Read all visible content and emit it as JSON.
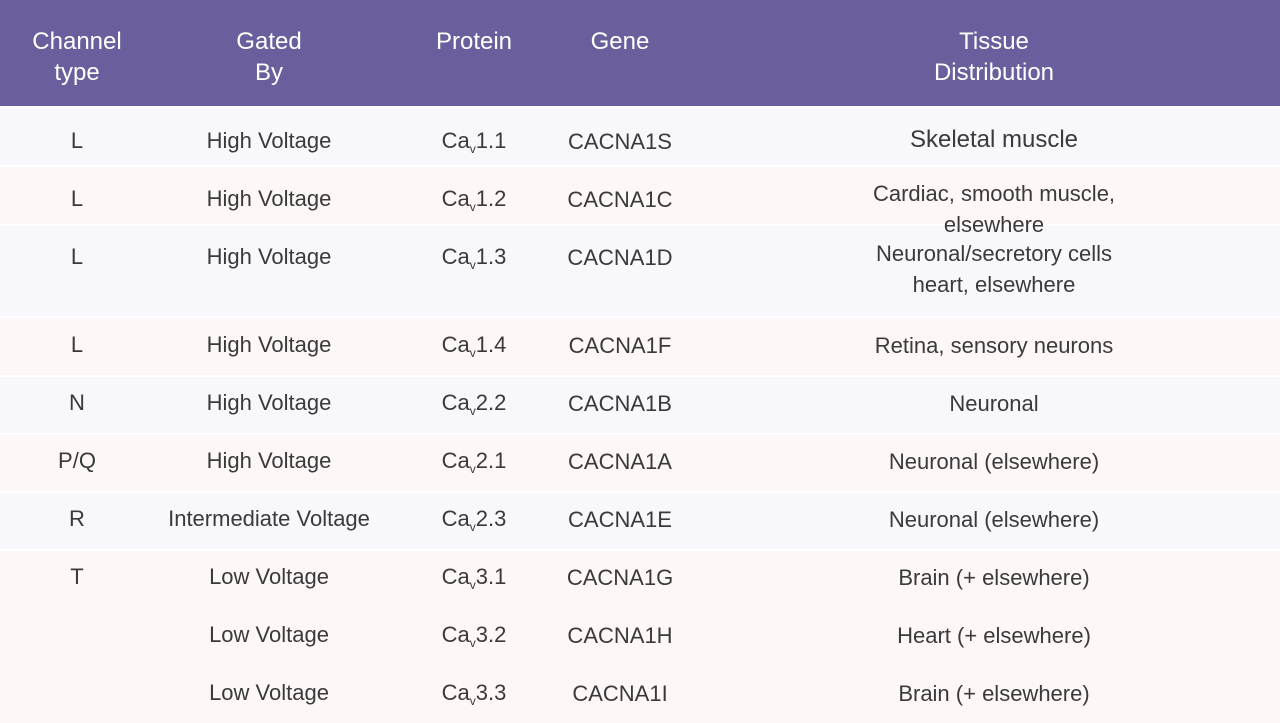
{
  "header": {
    "channel_type": "Channel\ntype",
    "gated_by": "Gated\nBy",
    "protein": "Protein",
    "gene": "Gene",
    "tissue": "Tissue\nDistribution"
  },
  "colors": {
    "header_bg": "#6a5f9c",
    "row_a": "#f7f7fc",
    "row_b": "#fdf8f7"
  },
  "rows": [
    {
      "type": "L",
      "gated": "High Voltage",
      "protein_base": "Ca",
      "protein_sub": "v",
      "protein_num": "1.1",
      "gene": "CACNA1S",
      "tissue": "Skeletal muscle"
    },
    {
      "type": "L",
      "gated": "High Voltage",
      "protein_base": "Ca",
      "protein_sub": "v",
      "protein_num": "1.2",
      "gene": "CACNA1C",
      "tissue": "Cardiac, smooth muscle, elsewhere"
    },
    {
      "type": "L",
      "gated": "High Voltage",
      "protein_base": "Ca",
      "protein_sub": "v",
      "protein_num": "1.3",
      "gene": "CACNA1D",
      "tissue": "Neuronal/secretory cells\nheart, elsewhere"
    },
    {
      "type": "L",
      "gated": "High Voltage",
      "protein_base": "Ca",
      "protein_sub": "v",
      "protein_num": "1.4",
      "gene": "CACNA1F",
      "tissue": "Retina, sensory neurons"
    },
    {
      "type": "N",
      "gated": "High Voltage",
      "protein_base": "Ca",
      "protein_sub": "v",
      "protein_num": "2.2",
      "gene": "CACNA1B",
      "tissue": "Neuronal"
    },
    {
      "type": "P/Q",
      "gated": "High Voltage",
      "protein_base": "Ca",
      "protein_sub": "v",
      "protein_num": "2.1",
      "gene": "CACNA1A",
      "tissue": "Neuronal (elsewhere)"
    },
    {
      "type": "R",
      "gated": "Intermediate Voltage",
      "protein_base": "Ca",
      "protein_sub": "v",
      "protein_num": "2.3",
      "gene": "CACNA1E",
      "tissue": "Neuronal (elsewhere)"
    },
    {
      "type": "T",
      "gated": "Low Voltage",
      "protein_base": "Ca",
      "protein_sub": "v",
      "protein_num": "3.1",
      "gene": "CACNA1G",
      "tissue": "Brain (+ elsewhere)"
    },
    {
      "type": "",
      "gated": "Low Voltage",
      "protein_base": "Ca",
      "protein_sub": "v",
      "protein_num": "3.2",
      "gene": "CACNA1H",
      "tissue": "Heart (+ elsewhere)"
    },
    {
      "type": "",
      "gated": "Low Voltage",
      "protein_base": "Ca",
      "protein_sub": "v",
      "protein_num": "3.3",
      "gene": "CACNA1I",
      "tissue": "Brain (+ elsewhere)"
    }
  ]
}
